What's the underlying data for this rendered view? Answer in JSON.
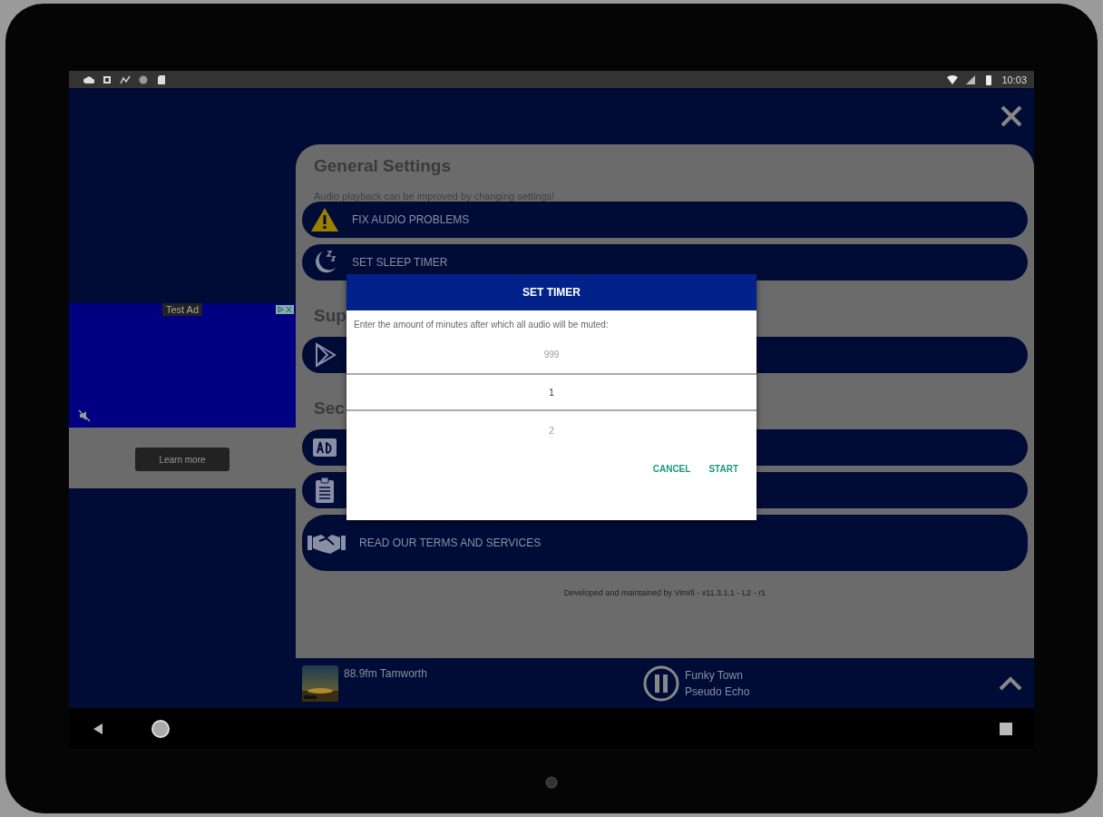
{
  "status_bar": {
    "time": "10:03"
  },
  "ad": {
    "badge": "Test Ad",
    "button": "Learn more"
  },
  "settings": {
    "sections": [
      {
        "title": "General Settings",
        "subtitle": "Audio playback can be improved by changing settings!",
        "rows": [
          {
            "kind": "warning",
            "label": "FIX AUDIO PROBLEMS"
          },
          {
            "kind": "moon",
            "label": "SET SLEEP TIMER"
          }
        ]
      },
      {
        "title": "Sup",
        "rows": [
          {
            "kind": "play"
          }
        ]
      },
      {
        "title": "Sec",
        "rows": [
          {
            "kind": "ad"
          },
          {
            "kind": "clipboard"
          },
          {
            "kind": "handshake",
            "label": "READ OUR TERMS AND SERVICES"
          }
        ]
      }
    ],
    "footer": "Developed and maintained by Vimrli - v11.3.1.1 - L2 - r1"
  },
  "player": {
    "station": "88.9fm Tamworth",
    "track": "Funky Town",
    "artist": "Pseudo Echo",
    "playing": true
  },
  "dialog": {
    "title": "SET TIMER",
    "prompt": "Enter the amount of minutes after which all audio will be muted:",
    "picker": [
      {
        "value": "999",
        "selected": false
      },
      {
        "value": "1",
        "selected": true
      },
      {
        "value": "2",
        "selected": false
      }
    ],
    "buttons": [
      "CANCEL",
      "START"
    ]
  }
}
